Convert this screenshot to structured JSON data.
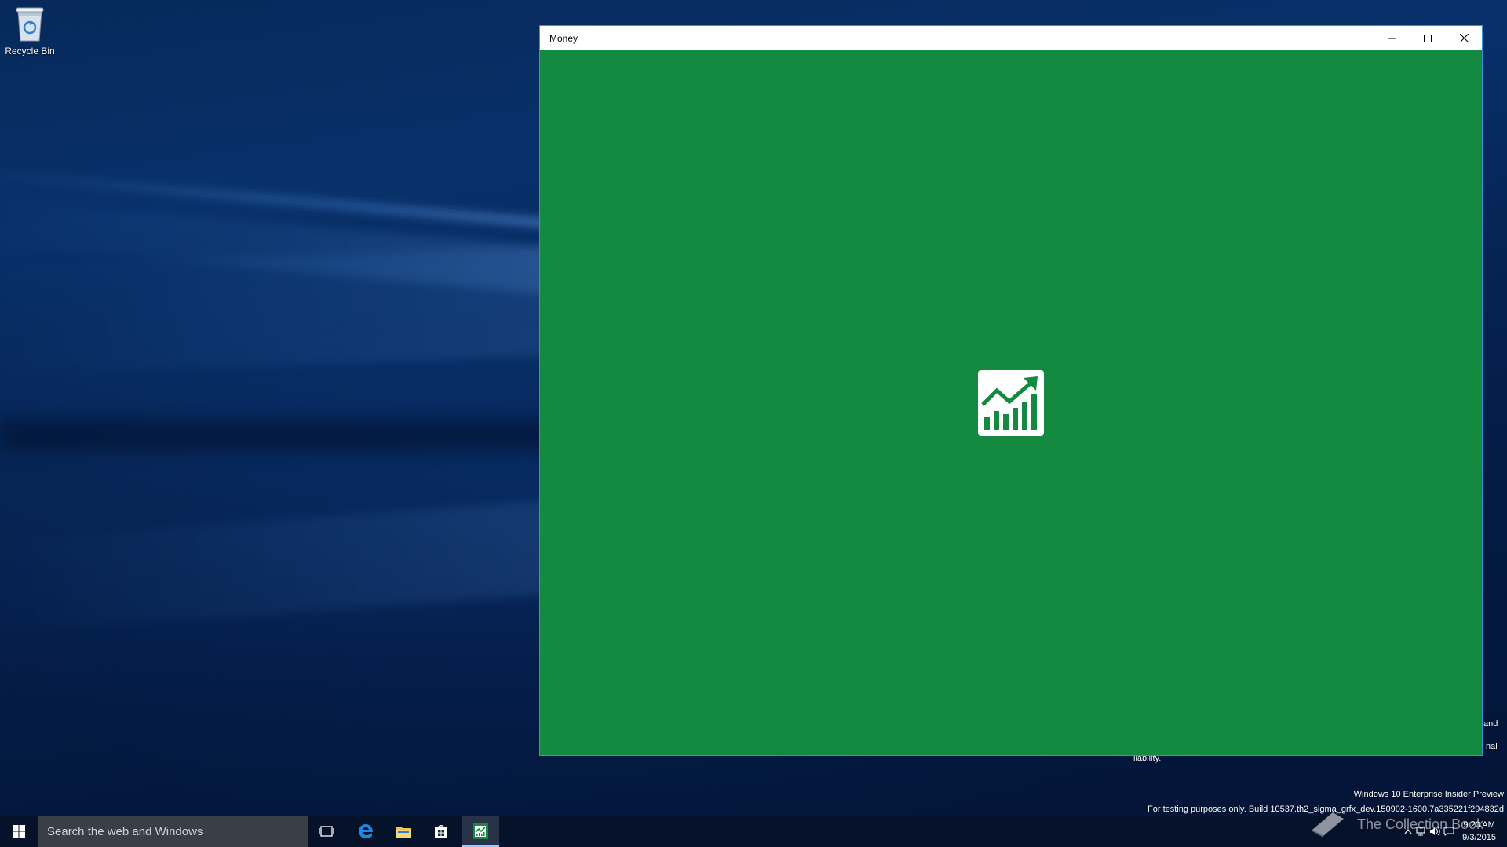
{
  "desktop": {
    "recycle_bin_label": "Recycle Bin",
    "watermark": {
      "partial_line_1": "and",
      "partial_line_2": "nal",
      "partial_line_3": "liability.",
      "edition": "Windows 10 Enterprise Insider Preview",
      "build": "For testing purposes only. Build 10537.th2_sigma_grfx_dev.150902-1600.7a335221f294832d"
    },
    "overlay_brand": "The Collection Book"
  },
  "window": {
    "title": "Money",
    "background_color": "#138a3f",
    "splash_icon": "money-chart-icon",
    "controls": {
      "minimize_icon": "minimize-icon",
      "maximize_icon": "maximize-icon",
      "close_icon": "close-icon"
    }
  },
  "taskbar": {
    "search_placeholder": "Search the web and Windows",
    "apps": [
      {
        "name": "Task View",
        "icon": "task-view-icon"
      },
      {
        "name": "Microsoft Edge",
        "icon": "edge-icon"
      },
      {
        "name": "File Explorer",
        "icon": "folder-icon"
      },
      {
        "name": "Store",
        "icon": "store-icon"
      },
      {
        "name": "Money",
        "icon": "money-icon",
        "active": true
      }
    ],
    "tray": {
      "time": "9:20 AM",
      "date": "9/3/2015"
    }
  }
}
